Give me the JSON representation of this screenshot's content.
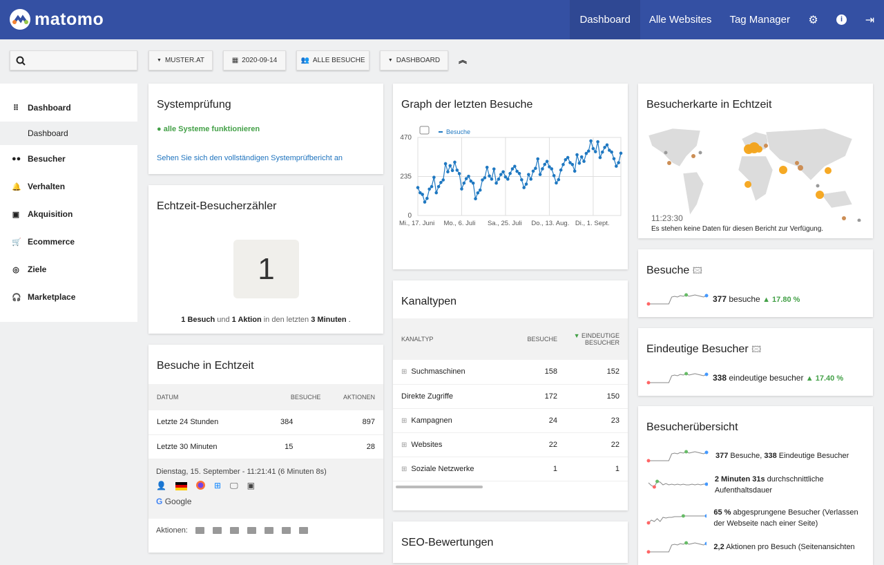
{
  "header": {
    "logo": "matomo",
    "nav": [
      {
        "label": "Dashboard",
        "active": true
      },
      {
        "label": "Alle Websites"
      },
      {
        "label": "Tag Manager"
      }
    ],
    "icons": [
      "gear-icon",
      "info-icon",
      "logout-icon"
    ],
    "color": "#3450a3"
  },
  "filters": {
    "search_placeholder": "",
    "site": "MUSTER.AT",
    "date": "2020-09-14",
    "segment": "ALLE BESUCHE",
    "dashboard": "DASHBOARD"
  },
  "sidebar": {
    "items": [
      {
        "label": "Dashboard",
        "icon": "grid-icon"
      },
      {
        "label": "Dashboard",
        "sub": true
      },
      {
        "label": "Besucher",
        "icon": "binoculars-icon"
      },
      {
        "label": "Verhalten",
        "icon": "bell-icon"
      },
      {
        "label": "Akquisition",
        "icon": "window-icon"
      },
      {
        "label": "Ecommerce",
        "icon": "cart-icon"
      },
      {
        "label": "Ziele",
        "icon": "target-icon"
      },
      {
        "label": "Marketplace",
        "icon": "headphones-icon"
      }
    ]
  },
  "system": {
    "title": "Systemprüfung",
    "status": "alle Systeme funktionieren",
    "link": "Sehen Sie sich den vollständigen Systemprüfbericht an"
  },
  "counter": {
    "title": "Echtzeit-Besucherzähler",
    "value": "1",
    "s1": "1 Besuch",
    "s2": " und ",
    "s3": "1 Aktion",
    "s4": " in den letzten ",
    "s5": "3 Minuten",
    "s6": " ."
  },
  "realtime": {
    "title": "Besuche in Echtzeit",
    "headers": [
      "DATUM",
      "BESUCHE",
      "AKTIONEN"
    ],
    "rows": [
      [
        "Letzte 24 Stunden",
        "384",
        "897"
      ],
      [
        "Letzte 30 Minuten",
        "15",
        "28"
      ]
    ],
    "visit_time": "Dienstag, 15. September - 11:21:41 (6 Minuten 8s)",
    "referrer": "Google",
    "actions_label": "Aktionen:"
  },
  "graph": {
    "title": "Graph der letzten Besuche",
    "legend": "Besuche"
  },
  "chart_data": {
    "type": "line",
    "series": [
      {
        "name": "Besuche",
        "values": [
          168,
          137,
          127,
          81,
          103,
          159,
          174,
          230,
          137,
          174,
          199,
          214,
          312,
          263,
          300,
          271,
          321,
          273,
          252,
          160,
          195,
          222,
          236,
          207,
          195,
          101,
          136,
          153,
          214,
          227,
          290,
          238,
          219,
          280,
          195,
          219,
          247,
          263,
          232,
          219,
          253,
          281,
          296,
          266,
          253,
          215,
          168,
          189,
          247,
          219,
          267,
          284,
          341,
          247,
          281,
          308,
          326,
          293,
          281,
          240,
          196,
          216,
          274,
          307,
          336,
          349,
          318,
          307,
          267,
          366,
          315,
          353,
          326,
          374,
          388,
          449,
          403,
          384,
          444,
          349,
          382,
          410,
          425,
          393,
          382,
          342,
          297,
          318,
          375
        ]
      }
    ],
    "x_ticks": [
      "Mi., 17. Juni",
      "Mo., 6. Juli",
      "Sa., 25. Juli",
      "Do., 13. Aug.",
      "Di., 1. Sept."
    ],
    "y_ticks": [
      "0",
      "235",
      "470"
    ],
    "ylim": [
      0,
      470
    ],
    "grid": true,
    "legend": "top-left",
    "color": "#1f78c1"
  },
  "channels": {
    "title": "Kanaltypen",
    "headers": [
      "KANALTYP",
      "BESUCHE",
      "EINDEUTIGE BESUCHER"
    ],
    "rows": [
      [
        "Suchmaschinen",
        "158",
        "152",
        true
      ],
      [
        "Direkte Zugriffe",
        "172",
        "150",
        false
      ],
      [
        "Kampagnen",
        "24",
        "23",
        true
      ],
      [
        "Websites",
        "22",
        "22",
        true
      ],
      [
        "Soziale Netzwerke",
        "1",
        "1",
        true
      ]
    ]
  },
  "seo": {
    "title": "SEO-Bewertungen"
  },
  "map": {
    "title": "Besucherkarte in Echtzeit",
    "time": "11:23:30",
    "nodata": "Es stehen keine Daten für diesen Bericht zur Verfügung."
  },
  "visits": {
    "title": "Besuche",
    "value": "377",
    "label": " besuche",
    "change": "17.80 %"
  },
  "unique": {
    "title": "Eindeutige Besucher",
    "value": "338",
    "label": " eindeutige besucher",
    "change": "17.40 %"
  },
  "overview": {
    "title": "Besucherübersicht",
    "items": [
      {
        "b": "377",
        "t": " Besuche, ",
        "b2": "338",
        "t2": " Eindeutige Besucher"
      },
      {
        "b": "2 Minuten 31s",
        "t": " durchschnittliche Aufenthaltsdauer"
      },
      {
        "b": "65 %",
        "t": " abgesprungene Besucher (Verlassen der Webseite nach einer Seite)"
      },
      {
        "b": "2,2",
        "t": " Aktionen pro Besuch (Seitenansichten"
      }
    ]
  }
}
